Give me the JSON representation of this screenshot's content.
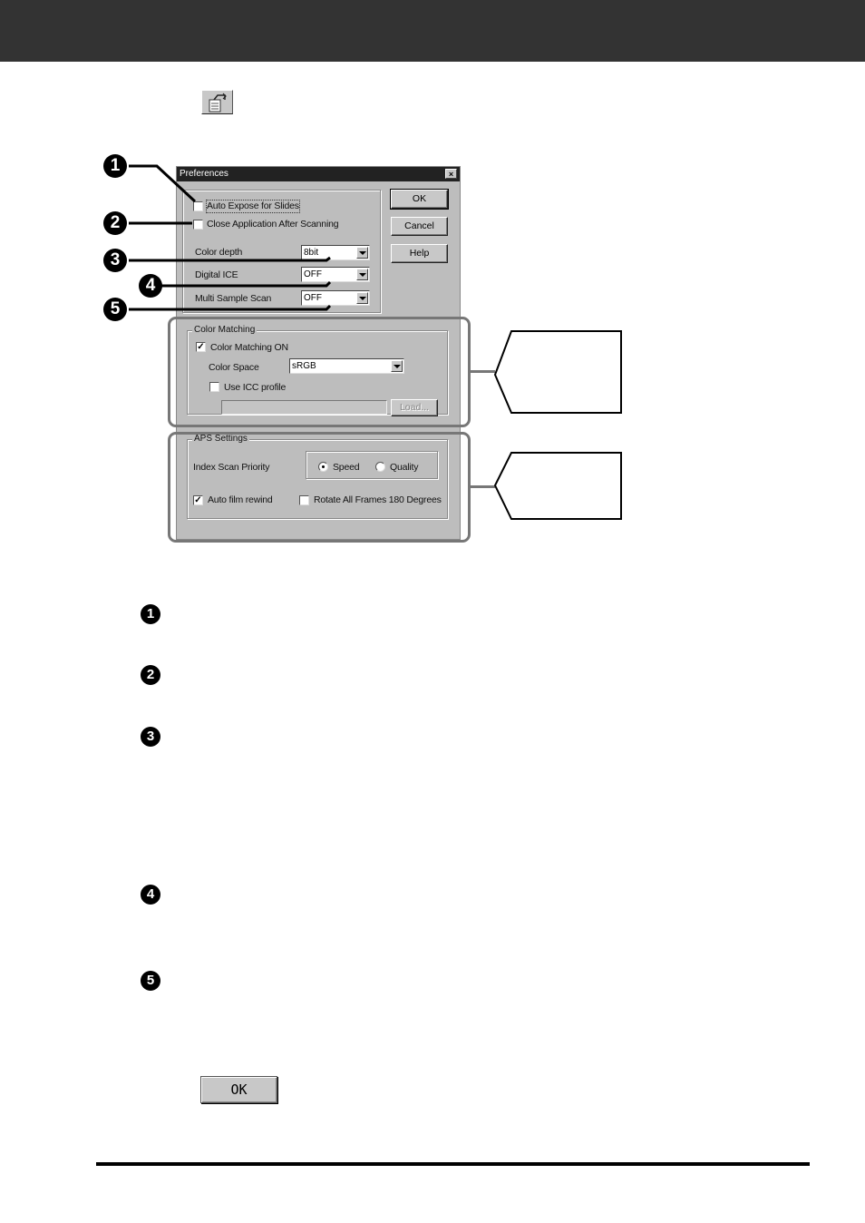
{
  "header": {
    "bar_color": "#333333"
  },
  "toolbar_icon": {
    "name": "preferences-icon"
  },
  "dialog": {
    "title": "Preferences",
    "close_glyph": "×",
    "checkboxes": {
      "auto_expose": {
        "label": "Auto Expose for Slides",
        "checked": false
      },
      "close_app": {
        "label": "Close Application After Scanning",
        "checked": false
      }
    },
    "color_depth": {
      "label": "Color depth",
      "value": "8bit"
    },
    "digital_ice": {
      "label": "Digital ICE",
      "value": "OFF"
    },
    "multi_sample": {
      "label": "Multi Sample Scan",
      "value": "OFF"
    },
    "buttons": {
      "ok": "OK",
      "cancel": "Cancel",
      "help": "Help"
    },
    "color_matching": {
      "group_label": "Color Matching",
      "on_label": "Color Matching ON",
      "on_checked": true,
      "space_label": "Color Space",
      "space_value": "sRGB",
      "icc_label": "Use ICC profile",
      "icc_checked": false,
      "icc_path": "",
      "load_label": "Load..."
    },
    "aps": {
      "group_label": "APS Settings",
      "priority_label": "Index Scan Priority",
      "speed_label": "Speed",
      "quality_label": "Quality",
      "selected": "Speed",
      "rewind_label": "Auto film rewind",
      "rewind_checked": true,
      "rotate_label": "Rotate All Frames 180 Degrees",
      "rotate_checked": false
    }
  },
  "markers": [
    "1",
    "2",
    "3",
    "4",
    "5"
  ],
  "check_glyph": "✓",
  "bottom_button": {
    "label": "OK"
  }
}
